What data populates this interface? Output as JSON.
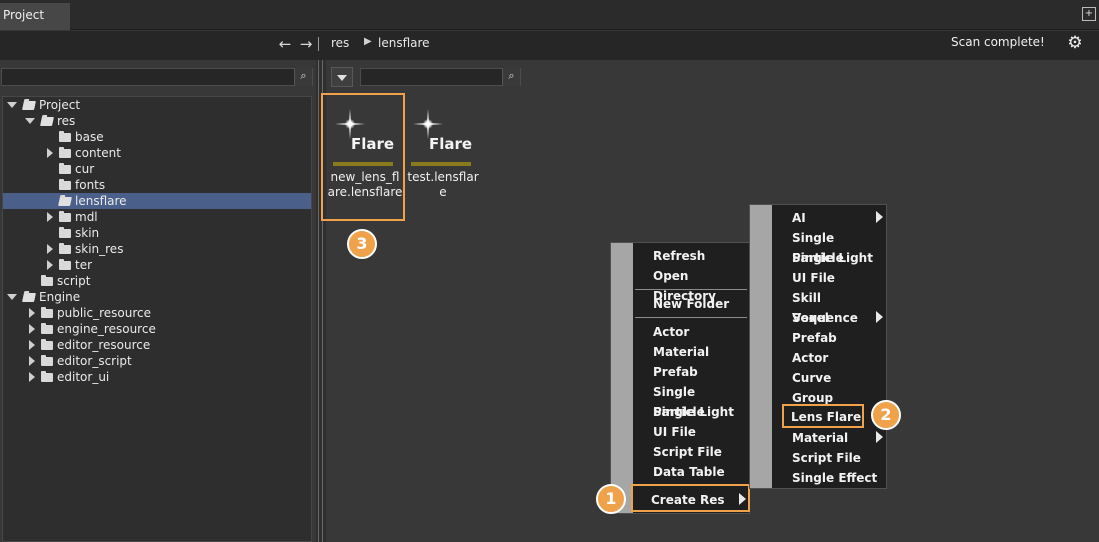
{
  "tab": {
    "title": "Project"
  },
  "toolbar": {
    "back_icon": "arrow-left-icon",
    "forward_icon": "arrow-right-icon",
    "breadcrumb": [
      "res",
      "lensflare"
    ],
    "status": "Scan complete!",
    "settings_icon": "gear-icon"
  },
  "tree": {
    "items": [
      {
        "label": "Project",
        "depth": 0,
        "expanded": true
      },
      {
        "label": "res",
        "depth": 1,
        "expanded": true
      },
      {
        "label": "base",
        "depth": 2
      },
      {
        "label": "content",
        "depth": 2,
        "has_children": true
      },
      {
        "label": "cur",
        "depth": 2
      },
      {
        "label": "fonts",
        "depth": 2
      },
      {
        "label": "lensflare",
        "depth": 2,
        "selected": true
      },
      {
        "label": "mdl",
        "depth": 2,
        "has_children": true
      },
      {
        "label": "skin",
        "depth": 2
      },
      {
        "label": "skin_res",
        "depth": 2,
        "has_children": true
      },
      {
        "label": "ter",
        "depth": 2,
        "has_children": true
      },
      {
        "label": "script",
        "depth": 1
      },
      {
        "label": "Engine",
        "depth": 0,
        "expanded": true
      },
      {
        "label": "public_resource",
        "depth": 1,
        "has_children": true
      },
      {
        "label": "engine_resource",
        "depth": 1,
        "has_children": true
      },
      {
        "label": "editor_resource",
        "depth": 1,
        "has_children": true
      },
      {
        "label": "editor_script",
        "depth": 1,
        "has_children": true
      },
      {
        "label": "editor_ui",
        "depth": 1,
        "has_children": true
      }
    ]
  },
  "assets": [
    {
      "icon_text": "Flare",
      "name": "new_lens_flare.lensflare"
    },
    {
      "icon_text": "Flare",
      "name": "test.lensflare"
    }
  ],
  "context_menu": {
    "items": [
      "Refresh",
      "Open Directory",
      "New Folder",
      "Actor",
      "Material",
      "Prefab",
      "Single Particle",
      "Single Light",
      "UI File",
      "Script File",
      "Data Table",
      "Create Res"
    ]
  },
  "submenu": {
    "items": [
      "AI",
      "Single Particle",
      "Single Light",
      "UI File",
      "Skill Sequence",
      "Voxel",
      "Prefab",
      "Actor",
      "Curve",
      "Group",
      "Lens Flare",
      "Material",
      "Script File",
      "Single Effect"
    ]
  },
  "badges": [
    "1",
    "2",
    "3"
  ],
  "colors": {
    "highlight": "#f0a24a",
    "selection": "#4a5f8a",
    "asset_bar": "#8a7a1e"
  }
}
